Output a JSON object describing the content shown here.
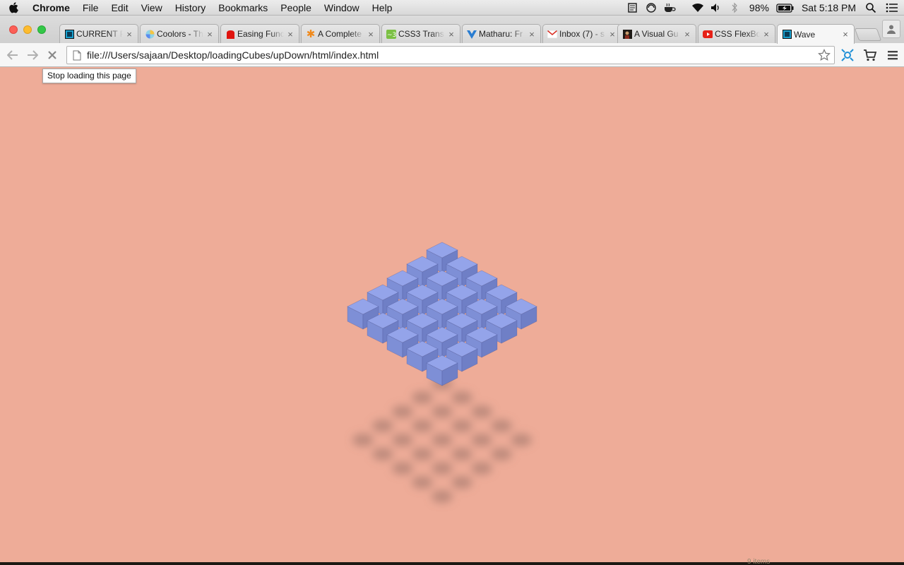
{
  "menubar": {
    "app_name": "Chrome",
    "items": [
      "File",
      "Edit",
      "View",
      "History",
      "Bookmarks",
      "People",
      "Window",
      "Help"
    ],
    "battery": "98%",
    "clock": "Sat 5:18 PM",
    "status_icons": [
      "notes-icon",
      "sync-icon",
      "coffee-icon",
      "wifi-icon",
      "volume-icon",
      "bluetooth-icon",
      "battery-icon",
      "search-icon",
      "list-icon"
    ]
  },
  "tabs": [
    {
      "title": "CURRENT P",
      "favicon": "square-teal",
      "active": false
    },
    {
      "title": "Coolors - Th",
      "favicon": "coolors",
      "active": false
    },
    {
      "title": "Easing Func",
      "favicon": "easing",
      "active": false
    },
    {
      "title": "A Complete",
      "favicon": "asterisk",
      "active": false
    },
    {
      "title": "CSS3 Trans",
      "favicon": "css3",
      "active": false
    },
    {
      "title": "Matharu: Fr",
      "favicon": "vue",
      "active": false
    },
    {
      "title": "Inbox (7) - s",
      "favicon": "gmail",
      "active": false
    },
    {
      "title": "A Visual Gu",
      "favicon": "dark",
      "active": false
    },
    {
      "title": "CSS FlexBo",
      "favicon": "youtube",
      "active": false
    },
    {
      "title": "Wave",
      "favicon": "square-teal",
      "active": true
    }
  ],
  "toolbar": {
    "url": "file:///Users/sajaan/Desktop/loadingCubes/upDown/html/index.html"
  },
  "tooltip": "Stop loading this page",
  "page": {
    "background": "#eeac98",
    "cube_top": "#94a4ea",
    "cube_left": "#7e8fd6",
    "cube_right": "#6f7fc6",
    "grid_rows": 5,
    "grid_cols": 5
  },
  "dock_text": "9 items"
}
